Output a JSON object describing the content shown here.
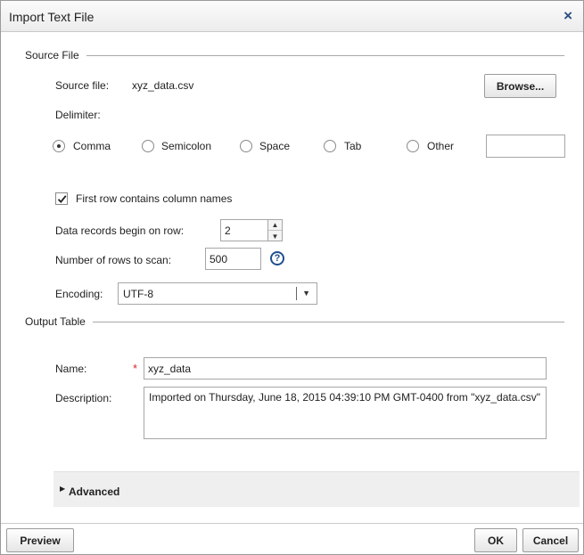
{
  "dialog": {
    "title": "Import Text File",
    "close_glyph": "×"
  },
  "source": {
    "legend": "Source File",
    "file_label": "Source file:",
    "file_value": "xyz_data.csv",
    "browse_label": "Browse...",
    "delimiter_label": "Delimiter:",
    "delimiters": [
      "Comma",
      "Semicolon",
      "Space",
      "Tab",
      "Other"
    ],
    "selected_delimiter": "Comma",
    "other_value": "",
    "first_row_label": "First row contains column names",
    "first_row_checked": true,
    "begin_row_label": "Data records begin on row:",
    "begin_row_value": "2",
    "scan_rows_label": "Number of rows to scan:",
    "scan_rows_value": "500",
    "encoding_label": "Encoding:",
    "encoding_value": "UTF-8"
  },
  "output": {
    "legend": "Output Table",
    "name_label": "Name:",
    "required_marker": "*",
    "name_value": "xyz_data",
    "description_label": "Description:",
    "description_value": "Imported on Thursday, June 18, 2015 04:39:10 PM GMT-0400 from \"xyz_data.csv\""
  },
  "advanced": {
    "label": "Advanced"
  },
  "footer": {
    "preview_label": "Preview",
    "ok_label": "OK",
    "cancel_label": "Cancel"
  },
  "icons": {
    "close": "close-icon",
    "help": "help-icon",
    "check": "checkmark-icon",
    "dropdown": "chevron-down-icon",
    "expand": "triangle-right-icon"
  },
  "colors": {
    "accent": "#1f4f8f",
    "required": "#dd2222",
    "titlebar": "#f2f2f2",
    "advanced_bg": "#efefef"
  }
}
